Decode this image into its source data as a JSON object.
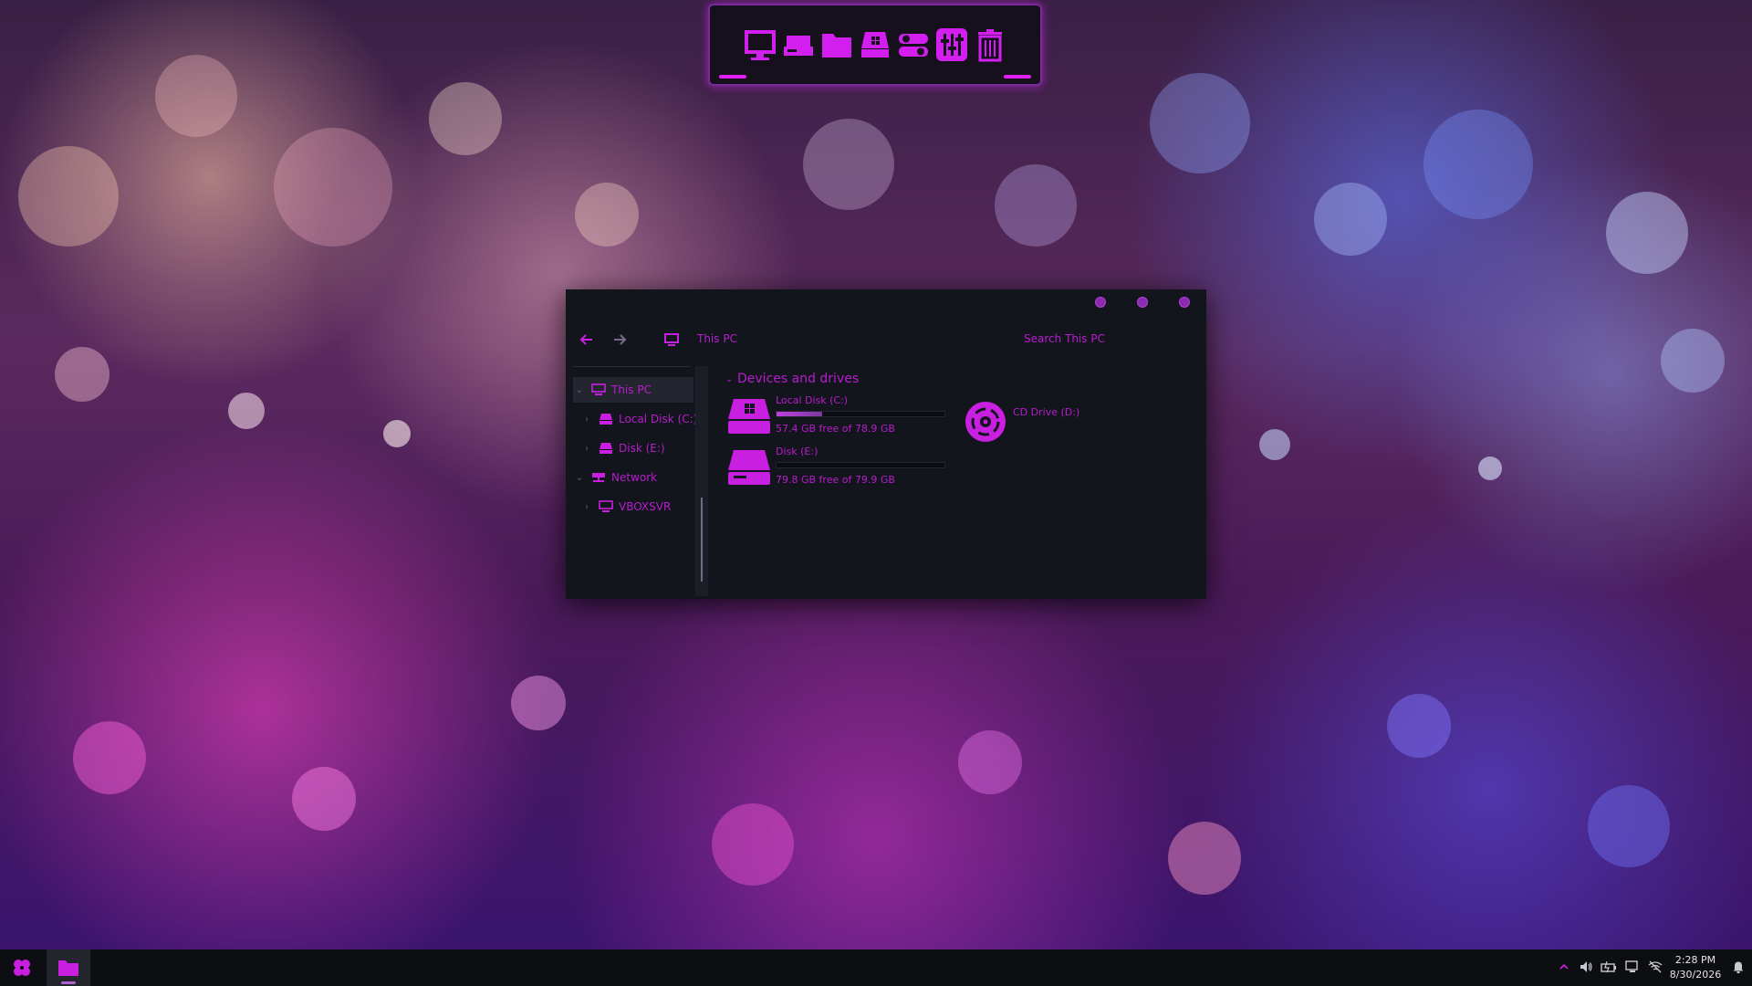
{
  "colors": {
    "accent": "#c81fe0",
    "window_bg": "#13151c",
    "taskbar_bg": "#0d0e12",
    "text_light": "#e6e6ea"
  },
  "dock": {
    "items": [
      {
        "icon": "monitor-icon"
      },
      {
        "icon": "drive-icon"
      },
      {
        "icon": "folder-icon"
      },
      {
        "icon": "windows-drive-icon"
      },
      {
        "icon": "toggle-switch-icon"
      },
      {
        "icon": "equalizer-icon"
      },
      {
        "icon": "trash-icon"
      }
    ]
  },
  "window": {
    "controls": [
      "minimize",
      "maximize",
      "close"
    ],
    "address": "This PC",
    "search_placeholder": "Search This PC",
    "sidebar": [
      {
        "label": "This PC",
        "icon": "computer-icon",
        "expanded": true,
        "selected": true,
        "level": 0
      },
      {
        "label": "Local Disk (C:)",
        "icon": "drive-icon",
        "expanded": false,
        "selected": false,
        "level": 1
      },
      {
        "label": "Disk (E:)",
        "icon": "drive-icon",
        "expanded": false,
        "selected": false,
        "level": 1
      },
      {
        "label": "Network",
        "icon": "network-icon",
        "expanded": true,
        "selected": false,
        "level": 0
      },
      {
        "label": "VBOXSVR",
        "icon": "computer-icon",
        "expanded": false,
        "selected": false,
        "level": 1
      }
    ],
    "group_title": "Devices and drives",
    "drives": [
      {
        "name": "Local Disk (C:)",
        "free": "57.4 GB free of 78.9 GB",
        "used_fraction": 0.27,
        "icon": "windows-drive-icon"
      },
      {
        "name": "Disk (E:)",
        "free": "79.8 GB free of 79.9 GB",
        "used_fraction": 0.0,
        "icon": "drive-icon"
      },
      {
        "name": "CD Drive (D:)",
        "icon": "cd-drive-icon"
      }
    ]
  },
  "taskbar": {
    "start_icon": "clover-start-icon",
    "pinned": [
      {
        "icon": "folder-icon",
        "active": true
      }
    ],
    "tray_icons": [
      "chevron-up-icon",
      "volume-icon",
      "battery-icon",
      "network-monitor-icon",
      "wifi-off-icon",
      "notification-bell-icon"
    ],
    "time": "2:28 PM",
    "date": "8/30/2026"
  }
}
